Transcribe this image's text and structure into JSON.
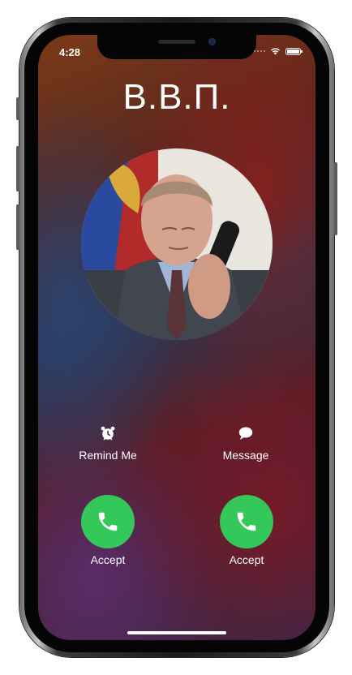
{
  "status_bar": {
    "time": "4:28"
  },
  "caller": {
    "name": "В.В.П."
  },
  "actions": {
    "remind": {
      "label": "Remind Me",
      "icon": "alarm-clock-icon"
    },
    "message": {
      "label": "Message",
      "icon": "speech-bubble-icon"
    },
    "accept_left": {
      "label": "Accept",
      "icon": "phone-icon"
    },
    "accept_right": {
      "label": "Accept",
      "icon": "phone-icon"
    }
  },
  "colors": {
    "accept_green": "#34c759",
    "text": "#ffffff"
  }
}
